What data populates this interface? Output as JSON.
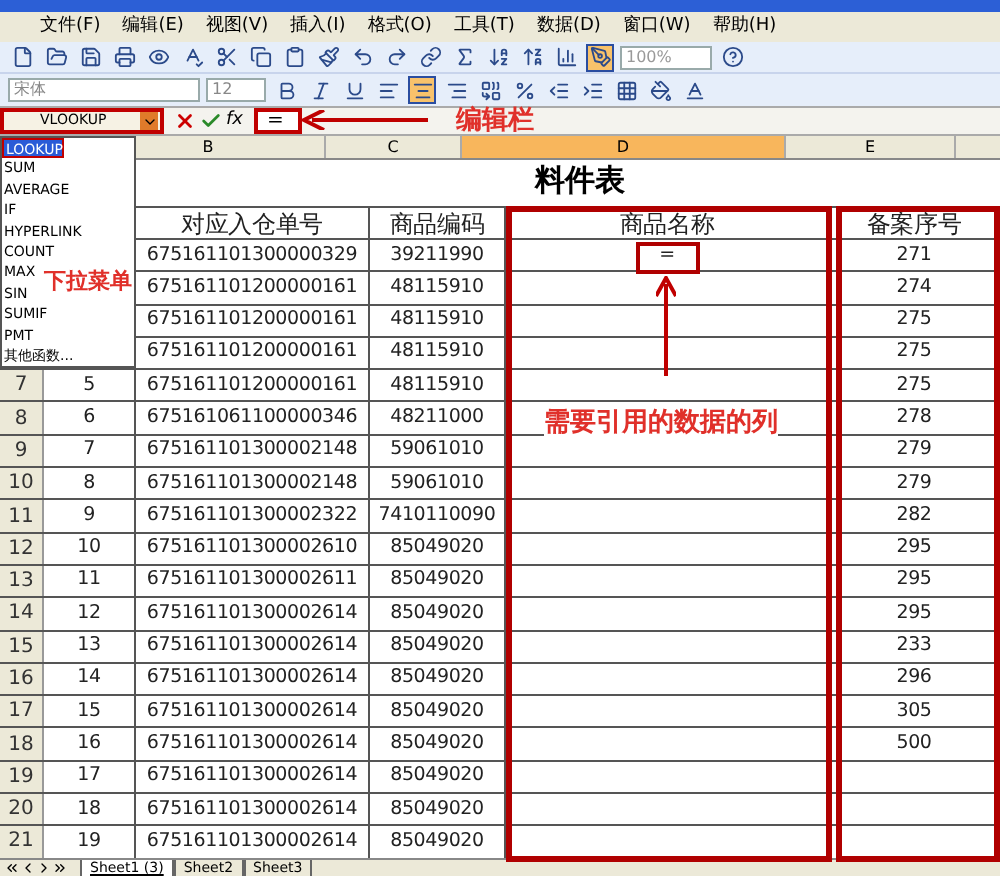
{
  "menu": [
    "文件(F)",
    "编辑(E)",
    "视图(V)",
    "插入(I)",
    "格式(O)",
    "工具(T)",
    "数据(D)",
    "窗口(W)",
    "帮助(H)"
  ],
  "toolbar": {
    "font": "宋体",
    "size": "12",
    "zoom": "100%"
  },
  "formula_bar": {
    "name_box": "VLOOKUP",
    "function_button": "fx",
    "formula": "="
  },
  "columns": [
    {
      "label": "B",
      "selected": false
    },
    {
      "label": "C",
      "selected": false
    },
    {
      "label": "D",
      "selected": true
    },
    {
      "label": "E",
      "selected": false
    }
  ],
  "sheet_title": "料件表",
  "header_row": {
    "b": "对应入仓单号",
    "c": "商品编码",
    "d": "商品名称",
    "e": "备案序号"
  },
  "rows": [
    {
      "b": "675161101300000329",
      "c": "39211990",
      "d": "=",
      "e": "271"
    },
    {
      "b": "675161101200000161",
      "c": "48115910",
      "e": "274"
    },
    {
      "b": "675161101200000161",
      "c": "48115910",
      "e": "275"
    },
    {
      "b": "675161101200000161",
      "c": "48115910",
      "e": "275"
    },
    {
      "row": "7",
      "a": "5",
      "b": "675161101200000161",
      "c": "48115910",
      "e": "275"
    },
    {
      "row": "8",
      "a": "6",
      "b": "675161061100000346",
      "c": "48211000",
      "e": "278"
    },
    {
      "row": "9",
      "a": "7",
      "b": "675161101300002148",
      "c": "59061010",
      "e": "279"
    },
    {
      "row": "10",
      "a": "8",
      "b": "675161101300002148",
      "c": "59061010",
      "e": "279"
    },
    {
      "row": "11",
      "a": "9",
      "b": "675161101300002322",
      "c": "7410110090",
      "e": "282"
    },
    {
      "row": "12",
      "a": "10",
      "b": "675161101300002610",
      "c": "85049020",
      "e": "295"
    },
    {
      "row": "13",
      "a": "11",
      "b": "675161101300002611",
      "c": "85049020",
      "e": "295"
    },
    {
      "row": "14",
      "a": "12",
      "b": "675161101300002614",
      "c": "85049020",
      "e": "295"
    },
    {
      "row": "15",
      "a": "13",
      "b": "675161101300002614",
      "c": "85049020",
      "e": "233"
    },
    {
      "row": "16",
      "a": "14",
      "b": "675161101300002614",
      "c": "85049020",
      "e": "296"
    },
    {
      "row": "17",
      "a": "15",
      "b": "675161101300002614",
      "c": "85049020",
      "e": "305"
    },
    {
      "row": "18",
      "a": "16",
      "b": "675161101300002614",
      "c": "85049020",
      "e": "500"
    },
    {
      "row": "19",
      "a": "17",
      "b": "675161101300002614",
      "c": "85049020"
    },
    {
      "row": "20",
      "a": "18",
      "b": "675161101300002614",
      "c": "85049020"
    },
    {
      "row": "21",
      "a": "19",
      "b": "675161101300002614",
      "c": "85049020"
    }
  ],
  "function_dropdown": [
    {
      "label": "LOOKUP",
      "selected": true
    },
    {
      "label": "SUM",
      "selected": false
    },
    {
      "label": "AVERAGE",
      "selected": false
    },
    {
      "label": "IF",
      "selected": false
    },
    {
      "label": "HYPERLINK",
      "selected": false
    },
    {
      "label": "COUNT",
      "selected": false
    },
    {
      "label": "MAX",
      "selected": false
    },
    {
      "label": "SIN",
      "selected": false
    },
    {
      "label": "SUMIF",
      "selected": false
    },
    {
      "label": "PMT",
      "selected": false
    },
    {
      "label": "其他函数...",
      "selected": false
    }
  ],
  "annotations": {
    "edit_bar": "编辑栏",
    "dropdown": "下拉菜单",
    "column": "需要引用的数据的列"
  },
  "sheet_tabs": [
    {
      "label": "Sheet1 (3)",
      "selected": true
    },
    {
      "label": "Sheet2",
      "selected": false
    },
    {
      "label": "Sheet3",
      "selected": false
    }
  ]
}
